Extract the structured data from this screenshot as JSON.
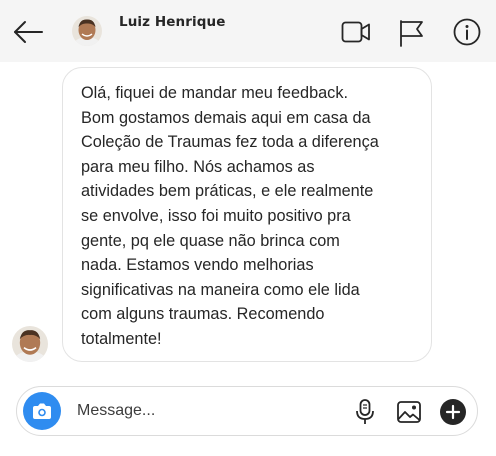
{
  "header": {
    "contact_name": "Luiz Henrique",
    "icons": {
      "back": "arrow-left-icon",
      "video": "video-camera-icon",
      "report": "flag-icon",
      "info": "info-icon"
    }
  },
  "conversation": {
    "messages": [
      {
        "sender": "Luiz Henrique",
        "text": "Olá, fiquei de mandar meu feedback.\nBom gostamos demais aqui em casa da\nColeção de Traumas fez toda a diferença\npara meu filho. Nós achamos as\natividades bem práticas, e ele realmente\nse envolve, isso foi muito positivo pra\ngente, pq ele quase não brinca com\nnada. Estamos vendo melhorias\nsignificativas na maneira como ele lida\ncom alguns traumas. Recomendo\ntotalmente!"
      }
    ]
  },
  "composer": {
    "placeholder": "Message...",
    "value": "",
    "icons": {
      "camera": "camera-icon",
      "mic": "microphone-icon",
      "gallery": "image-icon",
      "more": "plus-circle-icon"
    }
  },
  "colors": {
    "header_bg": "#f5f5f5",
    "camera_button": "#2f8cf0",
    "bubble_border": "#e3e3e3",
    "text": "#262626"
  }
}
